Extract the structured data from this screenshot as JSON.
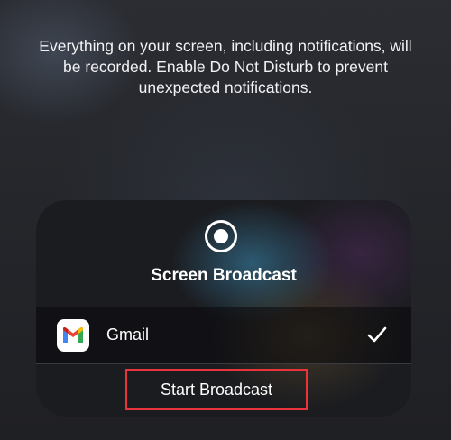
{
  "notice": {
    "text": "Everything on your screen, including notifications, will be recorded. Enable Do Not Disturb to prevent unexpected notifications."
  },
  "broadcast_panel": {
    "icon": "record-icon",
    "title": "Screen Broadcast",
    "selected_app": {
      "name": "Gmail",
      "icon": "gmail-icon",
      "selected": true,
      "selected_icon": "checkmark-icon"
    },
    "start_button_label": "Start Broadcast",
    "highlight_color": "#e8343a"
  }
}
